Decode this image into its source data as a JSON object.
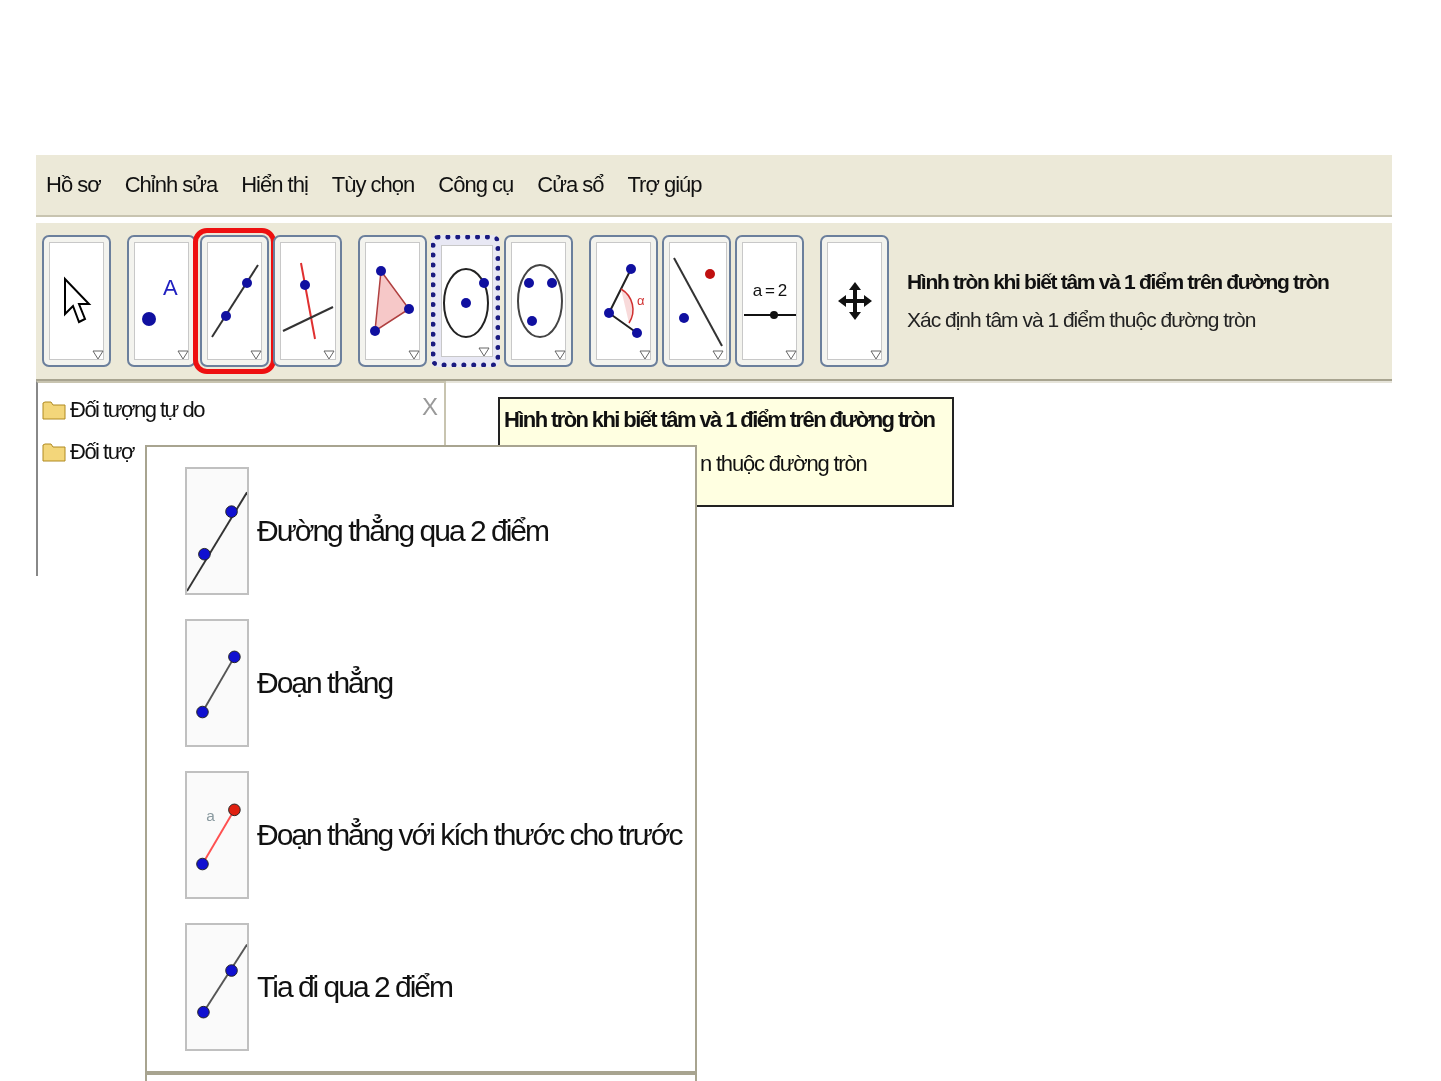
{
  "menu_bar": [
    {
      "label": "Hồ sơ"
    },
    {
      "label": "Chỉnh sửa"
    },
    {
      "label": "Hiển thị"
    },
    {
      "label": "Tùy chọn"
    },
    {
      "label": "Công cụ"
    },
    {
      "label": "Cửa sổ"
    },
    {
      "label": "Trợ giúp"
    }
  ],
  "toolbar": {
    "groups": [
      [
        {
          "kind": "move",
          "selected": false,
          "highlighted": false
        }
      ],
      [
        {
          "kind": "point",
          "icon_text": "A",
          "selected": false,
          "highlighted": false
        },
        {
          "kind": "line",
          "selected": false,
          "highlighted": true
        },
        {
          "kind": "perpendicular",
          "selected": false,
          "highlighted": false
        }
      ],
      [
        {
          "kind": "polygon",
          "selected": false,
          "highlighted": false
        },
        {
          "kind": "circle",
          "selected": true,
          "highlighted": false
        },
        {
          "kind": "conic",
          "selected": false,
          "highlighted": false
        }
      ],
      [
        {
          "kind": "angle",
          "icon_text": "α",
          "selected": false,
          "highlighted": false
        },
        {
          "kind": "reflect",
          "selected": false,
          "highlighted": false
        },
        {
          "kind": "slider",
          "icon_text": "a = 2",
          "selected": false,
          "highlighted": false
        }
      ],
      [
        {
          "kind": "move-view",
          "selected": false,
          "highlighted": false
        }
      ]
    ],
    "tool_title": "Hình tròn khi biết tâm và 1 điểm trên đường tròn",
    "tool_help": "Xác định tâm và 1 điểm thuộc đường tròn"
  },
  "algebra_view": {
    "close": "X",
    "folders": [
      {
        "label": "Đối tượng tự do"
      },
      {
        "label": "Đối tượ"
      }
    ]
  },
  "tooltip": {
    "title": "Hình tròn khi biết tâm và 1 điểm trên đường tròn",
    "text": "n thuộc đường tròn"
  },
  "popup_menu": {
    "items": [
      {
        "kind": "line",
        "label": "Đường thẳng qua 2 điểm"
      },
      {
        "kind": "segment",
        "label": "Đoạn thẳng"
      },
      {
        "kind": "segment-length",
        "icon_text": "a",
        "label": "Đoạn thẳng với kích thước cho trước"
      },
      {
        "kind": "ray",
        "label": "Tia đi qua 2 điểm"
      }
    ]
  }
}
